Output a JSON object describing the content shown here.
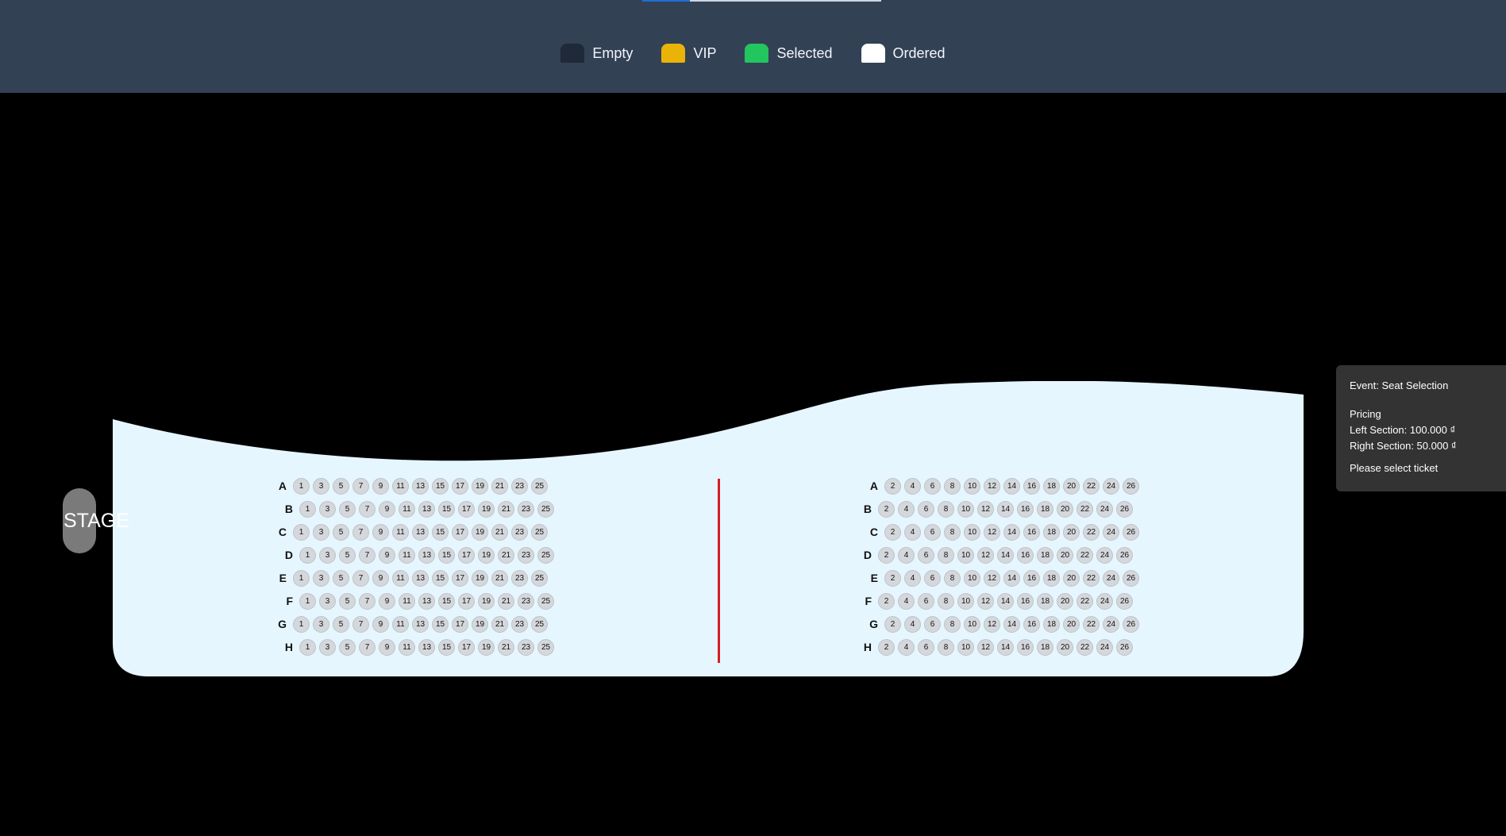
{
  "legend": [
    {
      "label": "Empty",
      "color": "#1f2937"
    },
    {
      "label": "VIP",
      "color": "#eab308"
    },
    {
      "label": "Selected",
      "color": "#22c55e"
    },
    {
      "label": "Ordered",
      "color": "#ffffff"
    }
  ],
  "stage": {
    "label": "STAGE"
  },
  "left_section": {
    "rows": [
      {
        "label": "A",
        "seats": [
          "1",
          "3",
          "5",
          "7",
          "9",
          "11",
          "13",
          "15",
          "17",
          "19",
          "21",
          "23",
          "25"
        ]
      },
      {
        "label": "B",
        "seats": [
          "1",
          "3",
          "5",
          "7",
          "9",
          "11",
          "13",
          "15",
          "17",
          "19",
          "21",
          "23",
          "25"
        ]
      },
      {
        "label": "C",
        "seats": [
          "1",
          "3",
          "5",
          "7",
          "9",
          "11",
          "13",
          "15",
          "17",
          "19",
          "21",
          "23",
          "25"
        ]
      },
      {
        "label": "D",
        "seats": [
          "1",
          "3",
          "5",
          "7",
          "9",
          "11",
          "13",
          "15",
          "17",
          "19",
          "21",
          "23",
          "25"
        ]
      },
      {
        "label": "E",
        "seats": [
          "1",
          "3",
          "5",
          "7",
          "9",
          "11",
          "13",
          "15",
          "17",
          "19",
          "21",
          "23",
          "25"
        ]
      },
      {
        "label": "F",
        "seats": [
          "1",
          "3",
          "5",
          "7",
          "9",
          "11",
          "13",
          "15",
          "17",
          "19",
          "21",
          "23",
          "25"
        ]
      },
      {
        "label": "G",
        "seats": [
          "1",
          "3",
          "5",
          "7",
          "9",
          "11",
          "13",
          "15",
          "17",
          "19",
          "21",
          "23",
          "25"
        ]
      },
      {
        "label": "H",
        "seats": [
          "1",
          "3",
          "5",
          "7",
          "9",
          "11",
          "13",
          "15",
          "17",
          "19",
          "21",
          "23",
          "25"
        ]
      }
    ]
  },
  "right_section": {
    "rows": [
      {
        "label": "A",
        "seats": [
          "2",
          "4",
          "6",
          "8",
          "10",
          "12",
          "14",
          "16",
          "18",
          "20",
          "22",
          "24",
          "26"
        ]
      },
      {
        "label": "B",
        "seats": [
          "2",
          "4",
          "6",
          "8",
          "10",
          "12",
          "14",
          "16",
          "18",
          "20",
          "22",
          "24",
          "26"
        ]
      },
      {
        "label": "C",
        "seats": [
          "2",
          "4",
          "6",
          "8",
          "10",
          "12",
          "14",
          "16",
          "18",
          "20",
          "22",
          "24",
          "26"
        ]
      },
      {
        "label": "D",
        "seats": [
          "2",
          "4",
          "6",
          "8",
          "10",
          "12",
          "14",
          "16",
          "18",
          "20",
          "22",
          "24",
          "26"
        ]
      },
      {
        "label": "E",
        "seats": [
          "2",
          "4",
          "6",
          "8",
          "10",
          "12",
          "14",
          "16",
          "18",
          "20",
          "22",
          "24",
          "26"
        ]
      },
      {
        "label": "F",
        "seats": [
          "2",
          "4",
          "6",
          "8",
          "10",
          "12",
          "14",
          "16",
          "18",
          "20",
          "22",
          "24",
          "26"
        ]
      },
      {
        "label": "G",
        "seats": [
          "2",
          "4",
          "6",
          "8",
          "10",
          "12",
          "14",
          "16",
          "18",
          "20",
          "22",
          "24",
          "26"
        ]
      },
      {
        "label": "H",
        "seats": [
          "2",
          "4",
          "6",
          "8",
          "10",
          "12",
          "14",
          "16",
          "18",
          "20",
          "22",
          "24",
          "26"
        ]
      }
    ]
  },
  "info_panel": {
    "event": "Event: Seat Selection",
    "pricing_title": "Pricing",
    "left_price": "Left Section: 100.000 ₫",
    "right_price": "Right Section: 50.000 ₫",
    "status": "Please select ticket"
  },
  "colors": {
    "header_bg": "#334155",
    "hall_bg": "#e6f6ff",
    "divider": "#d81d24",
    "seat_empty": "#d4d7db"
  }
}
